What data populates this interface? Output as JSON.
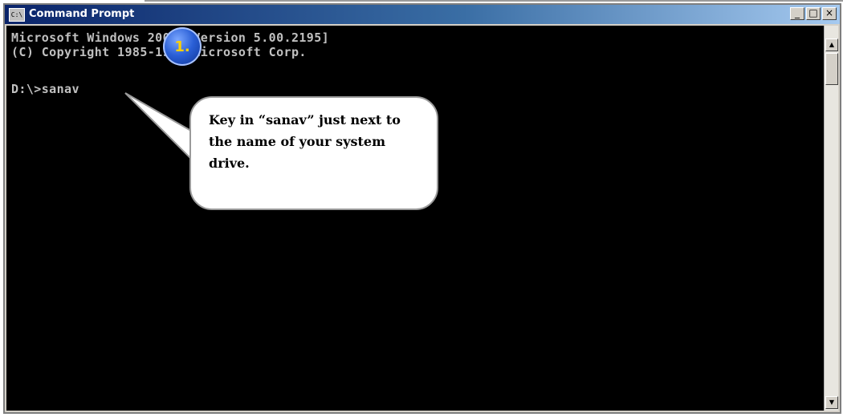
{
  "window": {
    "title": "Command Prompt",
    "icon_label": "C:\\",
    "buttons": {
      "minimize": "_",
      "maximize": "□",
      "close": "×"
    }
  },
  "console": {
    "lines": [
      "Microsoft Windows 2000 [Version 5.00.2195]",
      "(C) Copyright 1985-1999 Microsoft Corp.",
      "",
      "D:\\>sanav"
    ]
  },
  "scrollbar": {
    "up": "▲",
    "down": "▼"
  },
  "annotation": {
    "step_number": "1.",
    "callout_lines": [
      "Key in “sanav” just next to",
      "the name of your system",
      "drive."
    ]
  },
  "colors": {
    "titlebar_start": "#0a246a",
    "titlebar_end": "#a6caf0",
    "console_bg": "#000000",
    "console_text": "#c0c0c0",
    "badge": "#2a5fd6",
    "badge_text": "#ffd000"
  }
}
